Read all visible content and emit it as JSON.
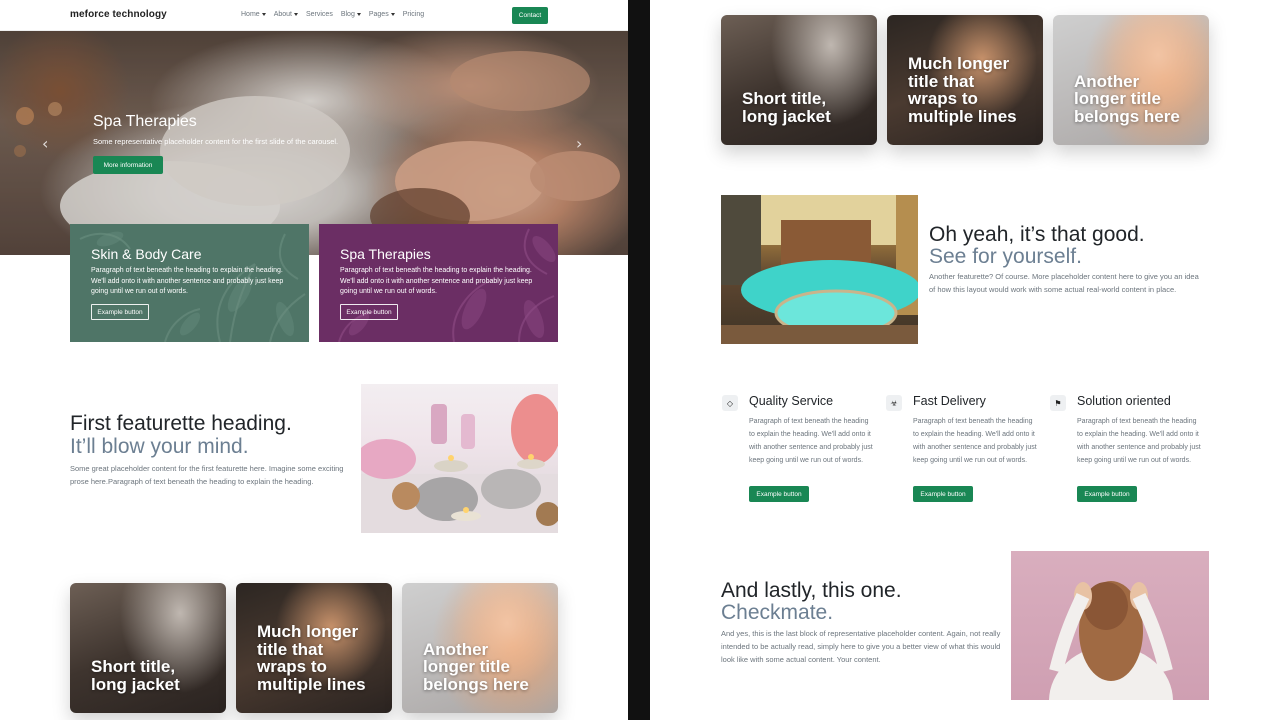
{
  "navbar": {
    "brand": "meforce technology",
    "links": [
      {
        "label": "Home",
        "dropdown": true
      },
      {
        "label": "About",
        "dropdown": true
      },
      {
        "label": "Services",
        "dropdown": false
      },
      {
        "label": "Blog",
        "dropdown": true
      },
      {
        "label": "Pages",
        "dropdown": true
      },
      {
        "label": "Pricing",
        "dropdown": false
      }
    ],
    "contact_label": "Contact"
  },
  "hero": {
    "title": "Spa Therapies",
    "text": "Some representative placeholder content for the first slide of the carousel.",
    "button_label": "More information",
    "prev_glyph": "‹",
    "next_glyph": "›"
  },
  "cards": [
    {
      "title": "Skin & Body Care",
      "text": "Paragraph of text beneath the heading to explain the heading. We'll add onto it with another sentence and probably just keep going until we run out of words.",
      "button_label": "Example button",
      "color": "#4f7567"
    },
    {
      "title": "Spa Therapies",
      "text": "Paragraph of text beneath the heading to explain the heading. We'll add onto it with another sentence and probably just keep going until we run out of words.",
      "button_label": "Example button",
      "color": "#6b2e64"
    }
  ],
  "featurette1": {
    "heading": "First featurette heading.",
    "subheading": "It’ll blow your mind.",
    "text": "Some great placeholder content for the first featurette here. Imagine some exciting prose here.Paragraph of text beneath the heading to explain the heading."
  },
  "tiles": [
    {
      "title": "Short title, long jacket"
    },
    {
      "title": "Much longer title that wraps to multiple lines"
    },
    {
      "title": "Another longer title belongs here"
    }
  ],
  "featurette2": {
    "heading": "Oh yeah, it’s that good.",
    "subheading": "See for yourself.",
    "text": "Another featurette? Of course. More placeholder content here to give you an idea of how this layout would work with some actual real-world content in place."
  },
  "features": [
    {
      "icon": "diamond-icon",
      "glyph": "◇",
      "title": "Quality Service",
      "text": "Paragraph of text beneath the heading to explain the heading. We'll add onto it with another sentence and probably just keep going until we run out of words.",
      "button_label": "Example button"
    },
    {
      "icon": "biohazard-icon",
      "glyph": "☣",
      "title": "Fast Delivery",
      "text": "Paragraph of text beneath the heading to explain the heading. We'll add onto it with another sentence and probably just keep going until we run out of words.",
      "button_label": "Example button"
    },
    {
      "icon": "flag-icon",
      "glyph": "⚑",
      "title": "Solution oriented",
      "text": "Paragraph of text beneath the heading to explain the heading. We'll add onto it with another sentence and probably just keep going until we run out of words.",
      "button_label": "Example button"
    }
  ],
  "featurette3": {
    "heading": "And lastly, this one.",
    "subheading": "Checkmate.",
    "text": "And yes, this is the last block of representative placeholder content. Again, not really intended to be actually read, simply here to give you a better view of what this would look like with some actual content. Your content."
  },
  "colors": {
    "accent": "#198754",
    "muted_heading": "#6c7f92",
    "text_muted": "#6c757d"
  }
}
